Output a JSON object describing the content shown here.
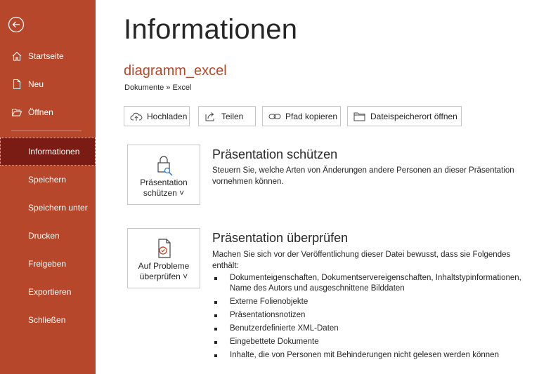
{
  "sidebar": {
    "back": {
      "icon": "back-arrow-icon"
    },
    "items": [
      {
        "label": "Startseite",
        "icon": "home-icon"
      },
      {
        "label": "Neu",
        "icon": "new-document-icon"
      },
      {
        "label": "Öffnen",
        "icon": "open-folder-icon"
      },
      {
        "label": "Informationen",
        "active": true
      },
      {
        "label": "Speichern"
      },
      {
        "label": "Speichern unter"
      },
      {
        "label": "Drucken"
      },
      {
        "label": "Freigeben"
      },
      {
        "label": "Exportieren"
      },
      {
        "label": "Schließen"
      }
    ]
  },
  "main": {
    "title": "Informationen",
    "file_name": "diagramm_excel",
    "breadcrumb": "Dokumente » Excel",
    "buttons": [
      {
        "label": "Hochladen",
        "icon": "cloud-upload-icon"
      },
      {
        "label": "Teilen",
        "icon": "share-icon"
      },
      {
        "label": "Pfad kopieren",
        "icon": "link-icon"
      },
      {
        "label": "Dateispeicherort öffnen",
        "icon": "folder-icon"
      }
    ],
    "protect": {
      "button_line1": "Präsentation",
      "button_line2": "schützen ˅",
      "title": "Präsentation schützen",
      "description": "Steuern Sie, welche Arten von Änderungen andere Personen an dieser Präsentation vornehmen können."
    },
    "inspect": {
      "button_line1": "Auf Probleme",
      "button_line2": "überprüfen ˅",
      "title": "Präsentation überprüfen",
      "description": "Machen Sie sich vor der Veröffentlichung dieser Datei bewusst, dass sie Folgendes enthält:",
      "items": [
        "Dokumenteigenschaften, Dokumentservereigenschaften, Inhaltstypinformationen, Name des Autors und ausgeschnittene Bilddaten",
        "Externe Folienobjekte",
        "Präsentationsnotizen",
        "Benutzerdefinierte XML-Daten",
        "Eingebettete Dokumente",
        "Inhalte, die von Personen mit Behinderungen nicht gelesen werden können"
      ]
    }
  },
  "colors": {
    "sidebar": "#b7472a",
    "active": "#7a1b14",
    "accent": "#b7472a"
  }
}
